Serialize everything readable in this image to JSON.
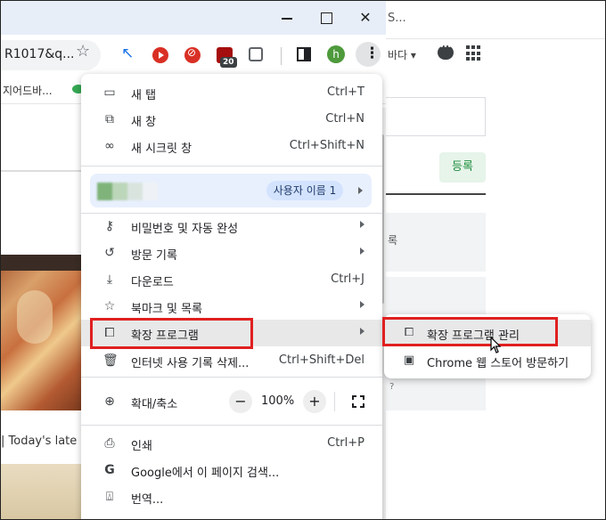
{
  "background_window": {
    "tab_title": "S...",
    "toolbar_text": "바다",
    "register_button": "등록",
    "side_text": "록",
    "question_mark": "?"
  },
  "browser": {
    "address_text": "R1017&q...",
    "extension_badge": "20",
    "avatar_letter": "h",
    "bookmark_text": "지어드바...",
    "page_caption": "| Today's late"
  },
  "menu": {
    "items": [
      {
        "label": "새 탭",
        "shortcut": "Ctrl+T",
        "icon": "new-tab-icon"
      },
      {
        "label": "새 창",
        "shortcut": "Ctrl+N",
        "icon": "new-window-icon"
      },
      {
        "label": "새 시크릿 창",
        "shortcut": "Ctrl+Shift+N",
        "icon": "incognito-icon"
      }
    ],
    "profile": {
      "name_chip": "사용자 이름 1"
    },
    "items2": [
      {
        "label": "비밀번호 및 자동 완성",
        "icon": "key-icon"
      },
      {
        "label": "방문 기록",
        "icon": "history-icon"
      },
      {
        "label": "다운로드",
        "shortcut": "Ctrl+J",
        "icon": "download-icon"
      },
      {
        "label": "북마크 및 목록",
        "icon": "bookmark-star-icon"
      },
      {
        "label": "확장 프로그램",
        "icon": "extension-puzzle-icon"
      },
      {
        "label": "인터넷 사용 기록 삭제...",
        "shortcut": "Ctrl+Shift+Del",
        "icon": "trash-icon"
      }
    ],
    "zoom": {
      "label": "확대/축소",
      "value": "100%",
      "minus": "−",
      "plus": "+"
    },
    "items3": [
      {
        "label": "인쇄",
        "shortcut": "Ctrl+P",
        "icon": "print-icon"
      },
      {
        "label": "Google에서 이 페이지 검색...",
        "icon": "google-icon"
      },
      {
        "label": "번역...",
        "icon": "translate-icon"
      }
    ]
  },
  "submenu": {
    "items": [
      {
        "label": "확장 프로그램 관리",
        "icon": "extension-puzzle-icon"
      },
      {
        "label": "Chrome 웹 스토어 방문하기",
        "icon": "web-store-icon"
      }
    ]
  },
  "colors": {
    "highlight_box": "#e02020",
    "profile_bg": "#e8f0fe",
    "chip_bg": "#d3e3fd"
  }
}
